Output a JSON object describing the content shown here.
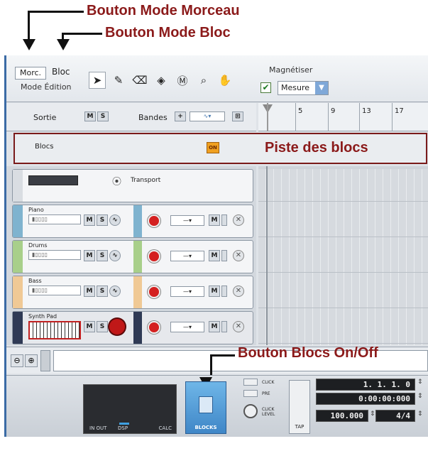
{
  "annotations": {
    "morceau": "Bouton Mode Morceau",
    "bloc": "Bouton Mode Bloc",
    "piste": "Piste des blocs",
    "onoff": "Bouton Blocs On/Off"
  },
  "toolbar": {
    "morc_label": "Morc.",
    "bloc_label": "Bloc",
    "mode_label": "Mode Édition",
    "magnet_label": "Magnétiser",
    "magnet_value": "Mesure"
  },
  "header": {
    "sortie": "Sortie",
    "bandes": "Bandes",
    "m": "M",
    "s": "S",
    "blocs": "Blocs",
    "on": "ON"
  },
  "ruler": {
    "ticks": [
      "5",
      "9",
      "13",
      "17"
    ]
  },
  "tracks": [
    {
      "name": "Transport",
      "color": "#d9dde2"
    },
    {
      "name": "Piano",
      "color": "#7fb3cf"
    },
    {
      "name": "Drums",
      "color": "#a8cf8a"
    },
    {
      "name": "Bass",
      "color": "#f0c995"
    },
    {
      "name": "Synth Pad",
      "color": "#2f3a55"
    }
  ],
  "transport": {
    "in_out": "IN OUT",
    "dsp": "DSP",
    "calc": "CALC",
    "blocks": "BLOCKS",
    "click": "CLICK",
    "pre": "PRE",
    "click_level": "CLICK LEVEL",
    "tap": "TAP",
    "position": "1. 1. 1. 0",
    "time": "0:00:00:000",
    "tempo": "100.000",
    "signature": "4/4"
  }
}
